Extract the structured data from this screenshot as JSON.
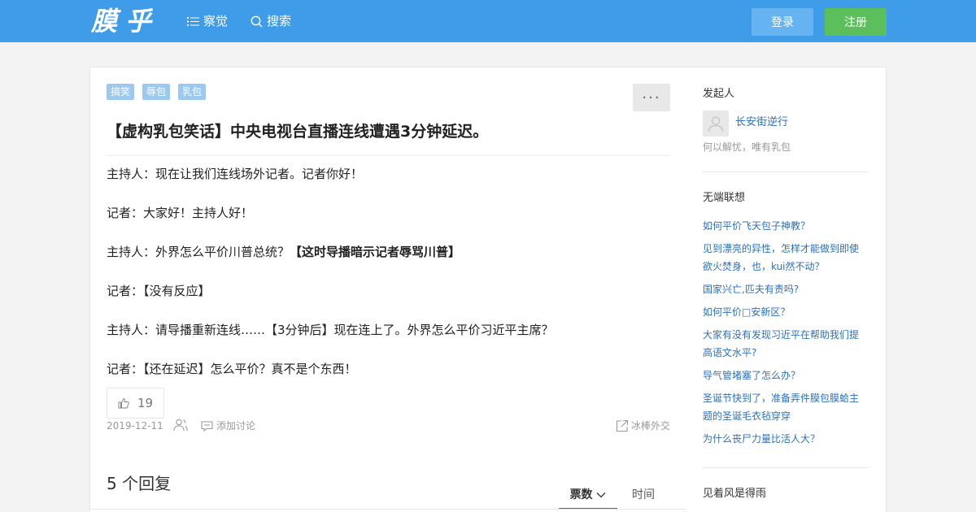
{
  "header": {
    "logo": "膜乎",
    "nav_browse": "察觉",
    "nav_search": "搜索",
    "login_label": "登录",
    "register_label": "注册"
  },
  "post": {
    "tags": [
      "搞笑",
      "辱包",
      "乳包"
    ],
    "more_label": "···",
    "title": "【虚构乳包笑话】中央电视台直播连线遭遇3分钟延迟。",
    "lines": [
      {
        "text": "主持人：现在让我们连线场外记者。记者你好！",
        "bold": ""
      },
      {
        "text": "记者：大家好！主持人好！",
        "bold": ""
      },
      {
        "text": "主持人：外界怎么平价川普总统？",
        "bold": "【这时导播暗示记者辱骂川普】"
      },
      {
        "text": "记者：【没有反应】",
        "bold": ""
      },
      {
        "text": "主持人：请导播重新连线……【3分钟后】现在连上了。外界怎么平价习近平主席？",
        "bold": ""
      },
      {
        "text": "记者：【还在延迟】怎么平价？真不是个东西！",
        "bold": ""
      }
    ],
    "votes": "19",
    "date": "2019-12-11",
    "add_discussion": "添加讨论",
    "share_label": "冰棒外交"
  },
  "replies": {
    "count_label": "5 个回复",
    "sort_votes": "票数",
    "sort_time": "时间"
  },
  "sidebar": {
    "initiator_heading": "发起人",
    "author_name": "长安街逆行",
    "author_bio": "何以解忧，唯有乳包",
    "related_heading": "无端联想",
    "related": [
      "如何平价飞天包子神教？",
      "见到漂亮的异性，怎样才能做到即使欲火焚身，也，kui然不动？",
      "国家兴亡,匹夫有责吗?",
      "如何平价□安新区？",
      "大家有没有发现习近平在帮助我们提高语文水平?",
      "导气管堵塞了怎么办？",
      "圣诞节快到了，准备弄件膜包膜蛤主题的圣诞毛衣毡穿穿",
      "为什么丧尸力量比活人大？"
    ],
    "bottom_heading": "见着风是得雨"
  },
  "colors": {
    "header_bg": "#3e9ce8",
    "login_bg": "#66b3f2",
    "register_bg": "#5bbf5b",
    "tag_bg": "#9cc9f0",
    "link": "#2e6fbd"
  }
}
